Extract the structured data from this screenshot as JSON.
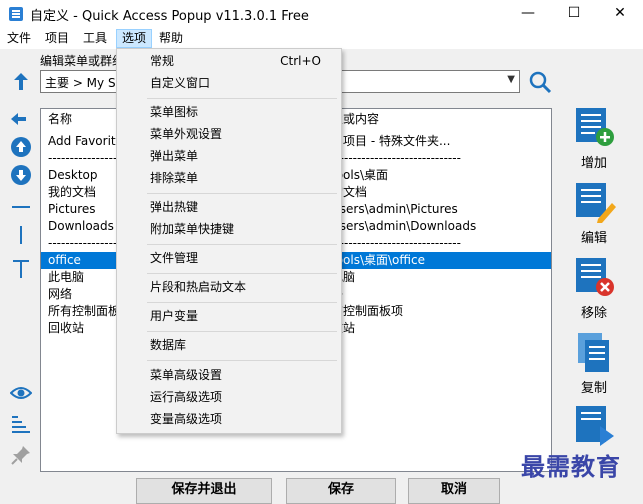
{
  "window": {
    "title": "自定义 - Quick Access Popup v11.3.0.1 Free",
    "minimize": "—",
    "maximize": "☐",
    "close": "✕"
  },
  "menubar": {
    "items": [
      {
        "label": "文件"
      },
      {
        "label": "项目"
      },
      {
        "label": "工具"
      },
      {
        "label": "选项"
      },
      {
        "label": "帮助"
      }
    ]
  },
  "editor": {
    "group_label": "编辑菜单或群组",
    "combo_value": "主要 > My S"
  },
  "list": {
    "header": {
      "name": "名称",
      "content": "置或内容"
    },
    "rows": [
      {
        "name": "Add Favorite",
        "content": "加项目 - 特殊文件夹..."
      },
      {
        "name": "----------------",
        "content": "------------------------------"
      },
      {
        "name": "Desktop",
        "content": "tools\\桌面"
      },
      {
        "name": "我的文档",
        "content": "的文档"
      },
      {
        "name": "Pictures",
        "content": "Users\\admin\\Pictures"
      },
      {
        "name": "Downloads",
        "content": "Users\\admin\\Downloads"
      },
      {
        "name": "----------------",
        "content": "------------------------------"
      },
      {
        "name": "office",
        "content": "tools\\桌面\\office"
      },
      {
        "name": "此电脑",
        "content": "电脑"
      },
      {
        "name": "网络",
        "content": "络"
      },
      {
        "name": "所有控制面板",
        "content": "有控制面板项"
      },
      {
        "name": "回收站",
        "content": "收站"
      }
    ]
  },
  "right_buttons": {
    "add": "增加",
    "edit": "编辑",
    "remove": "移除",
    "copy": "复制"
  },
  "bottom_buttons": {
    "save_exit": "保存并退出",
    "save": "保存",
    "cancel": "取消"
  },
  "options_menu": {
    "items": [
      {
        "label": "常规",
        "shortcut": "Ctrl+O"
      },
      {
        "label": "自定义窗口",
        "shortcut": ""
      },
      {
        "label": "菜单图标",
        "shortcut": ""
      },
      {
        "label": "菜单外观设置",
        "shortcut": ""
      },
      {
        "label": "弹出菜单",
        "shortcut": ""
      },
      {
        "label": "排除菜单",
        "shortcut": ""
      },
      {
        "label": "弹出热键",
        "shortcut": ""
      },
      {
        "label": "附加菜单快捷键",
        "shortcut": ""
      },
      {
        "label": "文件管理",
        "shortcut": ""
      },
      {
        "label": "片段和热启动文本",
        "shortcut": ""
      },
      {
        "label": "用户变量",
        "shortcut": ""
      },
      {
        "label": "数据库",
        "shortcut": ""
      },
      {
        "label": "菜单高级设置",
        "shortcut": ""
      },
      {
        "label": "运行高级选项",
        "shortcut": ""
      },
      {
        "label": "变量高级选项",
        "shortcut": ""
      }
    ]
  },
  "watermark": "最需教育",
  "colors": {
    "selection": "#0078d7",
    "menu_active": "#cce8ff",
    "icon_blue": "#1e73be",
    "watermark": "#3a46a8"
  }
}
